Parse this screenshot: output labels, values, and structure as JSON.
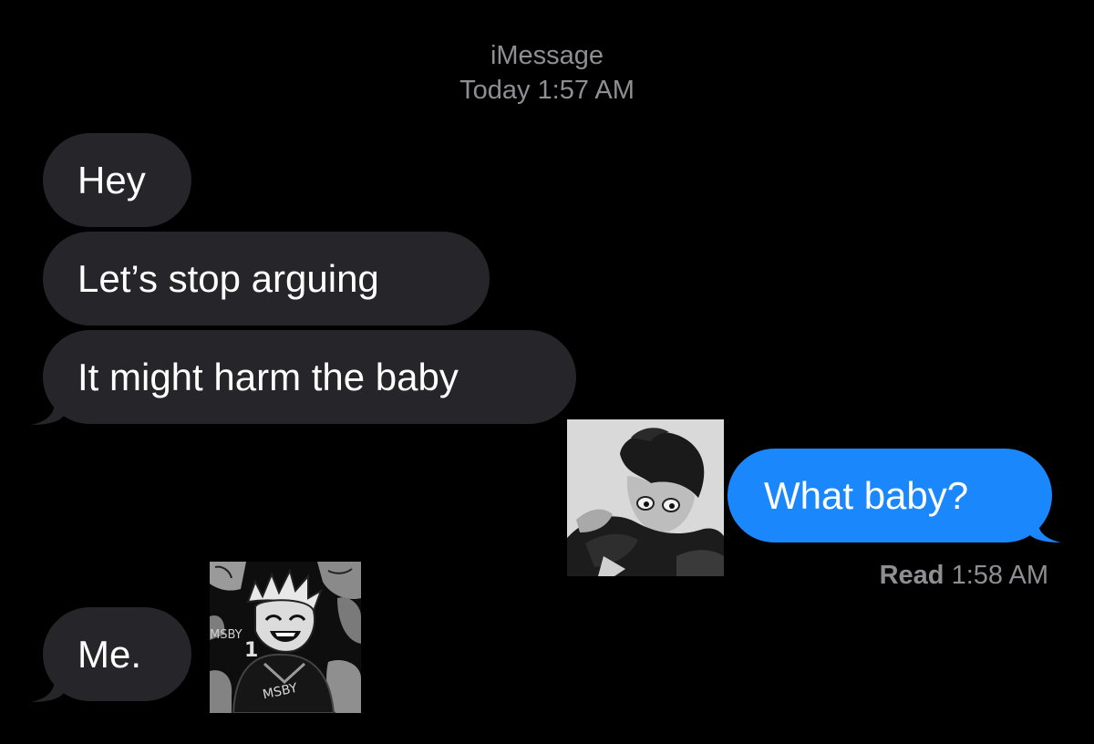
{
  "header": {
    "service": "iMessage",
    "day": "Today",
    "time": "1:57 AM"
  },
  "messages": [
    {
      "sender": "them",
      "text": "Hey"
    },
    {
      "sender": "them",
      "text": "Let’s stop arguing"
    },
    {
      "sender": "them",
      "text": "It might harm the baby"
    },
    {
      "sender": "me",
      "text": "What baby?"
    },
    {
      "sender": "them",
      "text": "Me."
    }
  ],
  "receipt": {
    "status": "Read",
    "time": "1:58 AM"
  },
  "stickers": [
    {
      "name": "dark-haired-boy-sticker"
    },
    {
      "name": "laughing-boy-sticker",
      "text": "MSBY"
    }
  ],
  "colors": {
    "background": "#000000",
    "incoming_bubble": "#26252a",
    "outgoing_bubble": "#1b87fd",
    "meta_text": "#8e8e93"
  }
}
